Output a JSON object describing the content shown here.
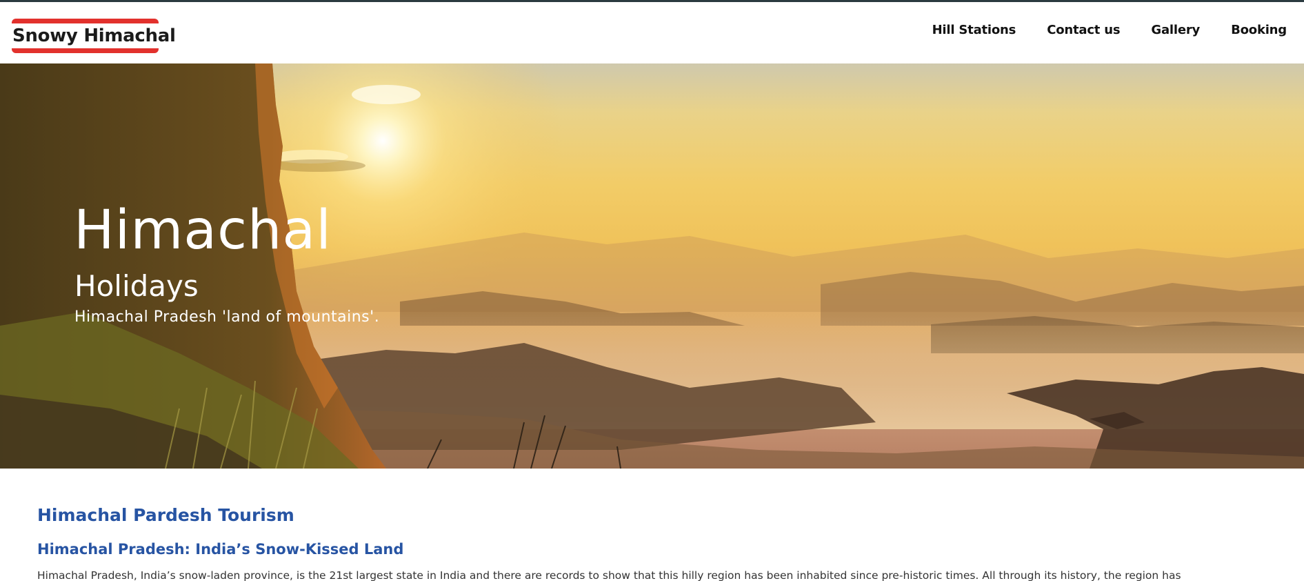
{
  "brand": {
    "name": "Snowy Himachal",
    "accent_color": "#e2312d"
  },
  "nav": {
    "items": [
      {
        "label": "Hill Stations"
      },
      {
        "label": "Contact us"
      },
      {
        "label": "Gallery"
      },
      {
        "label": "Booking"
      }
    ]
  },
  "hero": {
    "title": "Himachal",
    "subtitle": "Holidays",
    "tagline": "Himachal Pradesh 'land of mountains'."
  },
  "section": {
    "title": "Himachal Pardesh Tourism",
    "subtitle": "Himachal Pradesh: India’s Snow-Kissed Land",
    "body": "Himachal Pradesh, India’s snow-laden province, is the 21st largest state in India and there are records to show that this hilly region has been inhabited since pre-historic times. All through its history, the region has",
    "heading_color": "#2754a3"
  }
}
